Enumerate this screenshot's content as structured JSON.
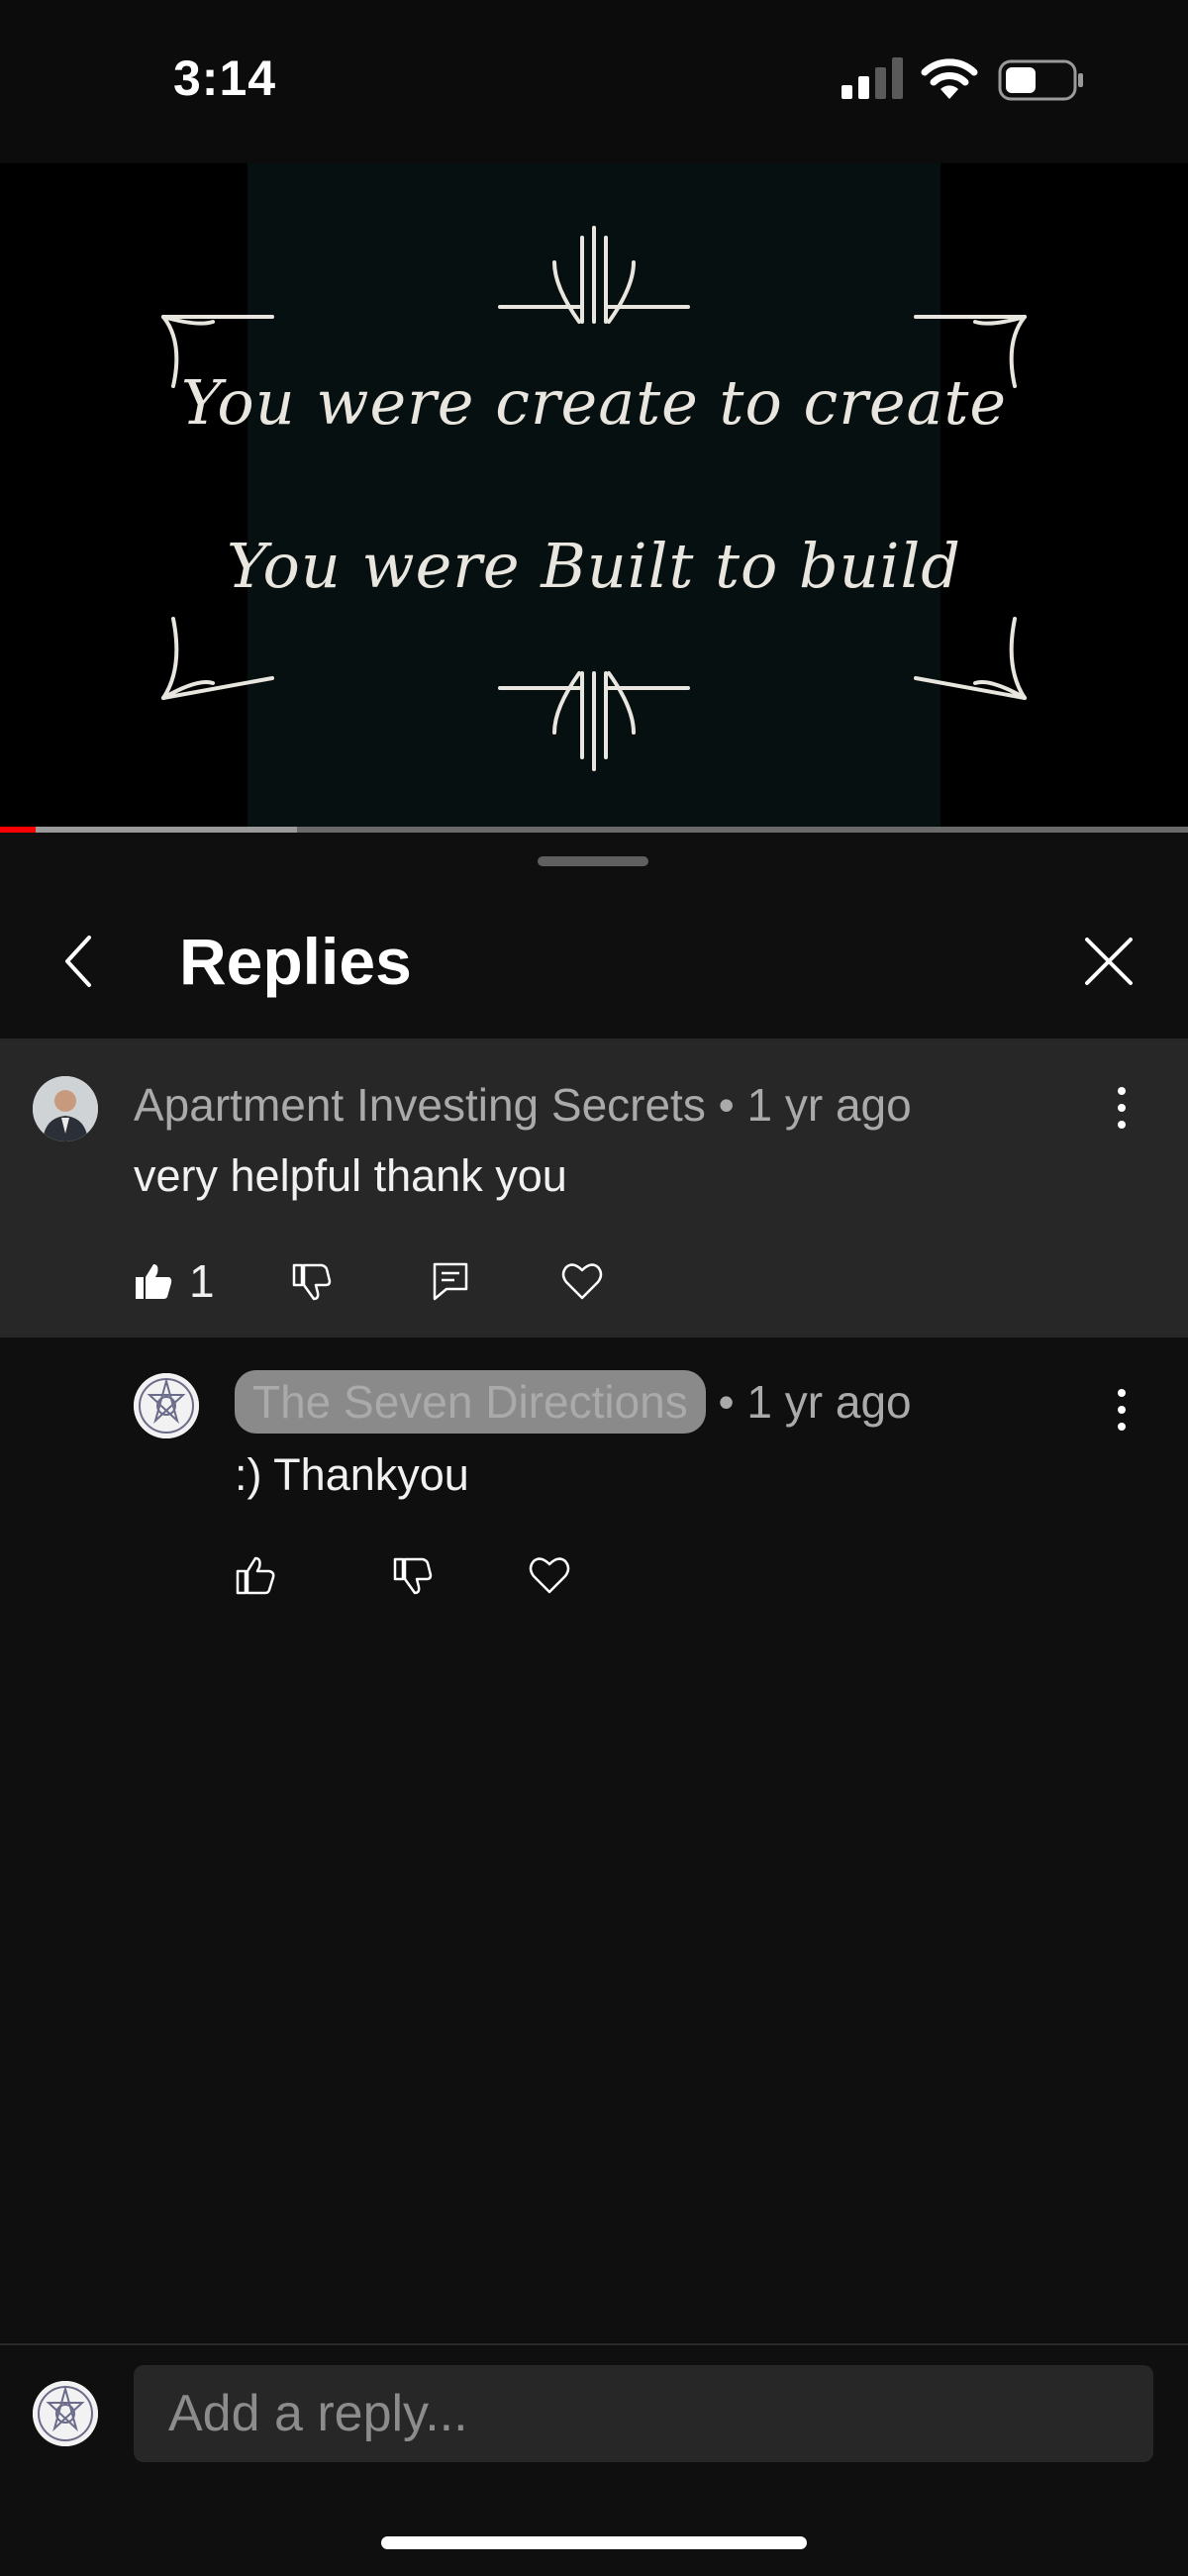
{
  "status_bar": {
    "time": "3:14"
  },
  "video": {
    "line1": "You were create to create",
    "line2": "You were Built to build",
    "progress": {
      "played_fraction": 0.03,
      "buffered_fraction": 0.25
    },
    "colors": {
      "played": "#ff0000",
      "buffered": "#9a9a9a",
      "track": "#6a6a6a"
    }
  },
  "sheet": {
    "title": "Replies"
  },
  "parent_comment": {
    "author": "Apartment Investing Secrets",
    "time": "• 1 yr ago",
    "text": "very helpful thank you",
    "like_count": "1"
  },
  "reply": {
    "author": "The Seven Directions",
    "time": "• 1 yr ago",
    "text": ":) Thankyou"
  },
  "reply_bar": {
    "placeholder": "Add a reply..."
  },
  "icons": {
    "back": "chevron-left-icon",
    "close": "close-icon",
    "more": "more-vert-icon",
    "like": "thumb-up-icon",
    "dislike": "thumb-down-icon",
    "reply": "reply-icon",
    "heart": "heart-icon"
  }
}
